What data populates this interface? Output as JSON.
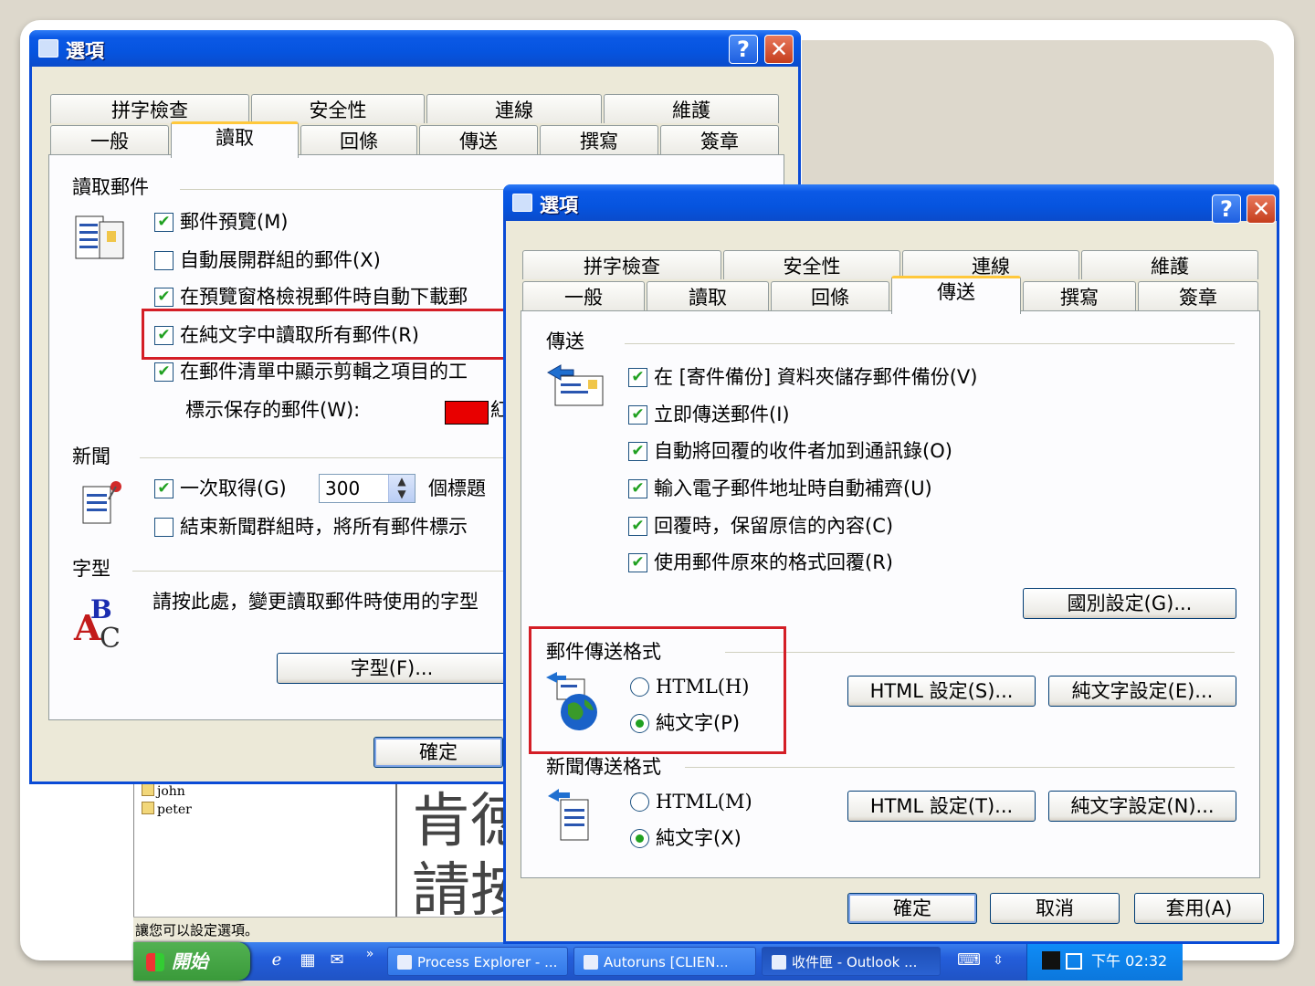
{
  "background": {
    "tree_items": [
      "john",
      "peter"
    ],
    "big_text_1": "肯徳",
    "big_text_2": "請按",
    "status_text": "讓您可以設定選項。"
  },
  "taskbar": {
    "start_label": "開始",
    "tasks": [
      {
        "label": "Process Explorer - ..."
      },
      {
        "label": "Autoruns [CLIEN..."
      },
      {
        "label": "收件匣 - Outlook ..."
      }
    ],
    "clock": "下午 02:32"
  },
  "dialog_read": {
    "title": "選項",
    "tabs_top": [
      "拼字檢查",
      "安全性",
      "連線",
      "維護"
    ],
    "tabs_bottom": [
      "一般",
      "讀取",
      "回條",
      "傳送",
      "撰寫",
      "簽章"
    ],
    "selected_tab": "讀取",
    "group_read": "讀取郵件",
    "options": [
      {
        "label": "郵件預覽(M)",
        "checked": true
      },
      {
        "label": "自動展開群組的郵件(X)",
        "checked": false
      },
      {
        "label": "在預覽窗格檢視郵件時自動下載郵",
        "checked": true
      },
      {
        "label": "在純文字中讀取所有郵件(R)",
        "checked": true
      },
      {
        "label": "在郵件清單中顯示剪輯之項目的工",
        "checked": true
      }
    ],
    "saved_label": "標示保存的郵件(W):",
    "saved_color_text": "紅",
    "group_news": "新聞",
    "news_get_label": "一次取得(G)",
    "news_get_value": "300",
    "news_get_suffix": "個標題",
    "news_mark_label": "結束新聞群組時，將所有郵件標示",
    "news_mark_checked": false,
    "group_font": "字型",
    "font_text": "請按此處，變更讀取郵件時使用的字型",
    "font_button": "字型(F)...",
    "ok_button": "確定",
    "highlight_color": "#d41e26"
  },
  "dialog_send": {
    "title": "選項",
    "tabs_top": [
      "拼字檢查",
      "安全性",
      "連線",
      "維護"
    ],
    "tabs_bottom": [
      "一般",
      "讀取",
      "回條",
      "傳送",
      "撰寫",
      "簽章"
    ],
    "selected_tab": "傳送",
    "group_send": "傳送",
    "options": [
      {
        "label": "在 [寄件備份] 資料夾儲存郵件備份(V)",
        "checked": true
      },
      {
        "label": "立即傳送郵件(I)",
        "checked": true
      },
      {
        "label": "自動將回覆的收件者加到通訊錄(O)",
        "checked": true
      },
      {
        "label": "輸入電子郵件地址時自動補齊(U)",
        "checked": true
      },
      {
        "label": "回覆時，保留原信的內容(C)",
        "checked": true
      },
      {
        "label": "使用郵件原來的格式回覆(R)",
        "checked": true
      }
    ],
    "intl_button": "國別設定(G)...",
    "group_mail_format": "郵件傳送格式",
    "mail_html": "HTML(H)",
    "mail_plain": "純文字(P)",
    "mail_selected": "plain",
    "mail_html_settings": "HTML 設定(S)...",
    "mail_plain_settings": "純文字設定(E)...",
    "group_news_format": "新聞傳送格式",
    "news_html": "HTML(M)",
    "news_plain": "純文字(X)",
    "news_selected": "plain",
    "news_html_settings": "HTML 設定(T)...",
    "news_plain_settings": "純文字設定(N)...",
    "ok_button": "確定",
    "cancel_button": "取消",
    "apply_button": "套用(A)",
    "highlight_color": "#d41e26"
  }
}
